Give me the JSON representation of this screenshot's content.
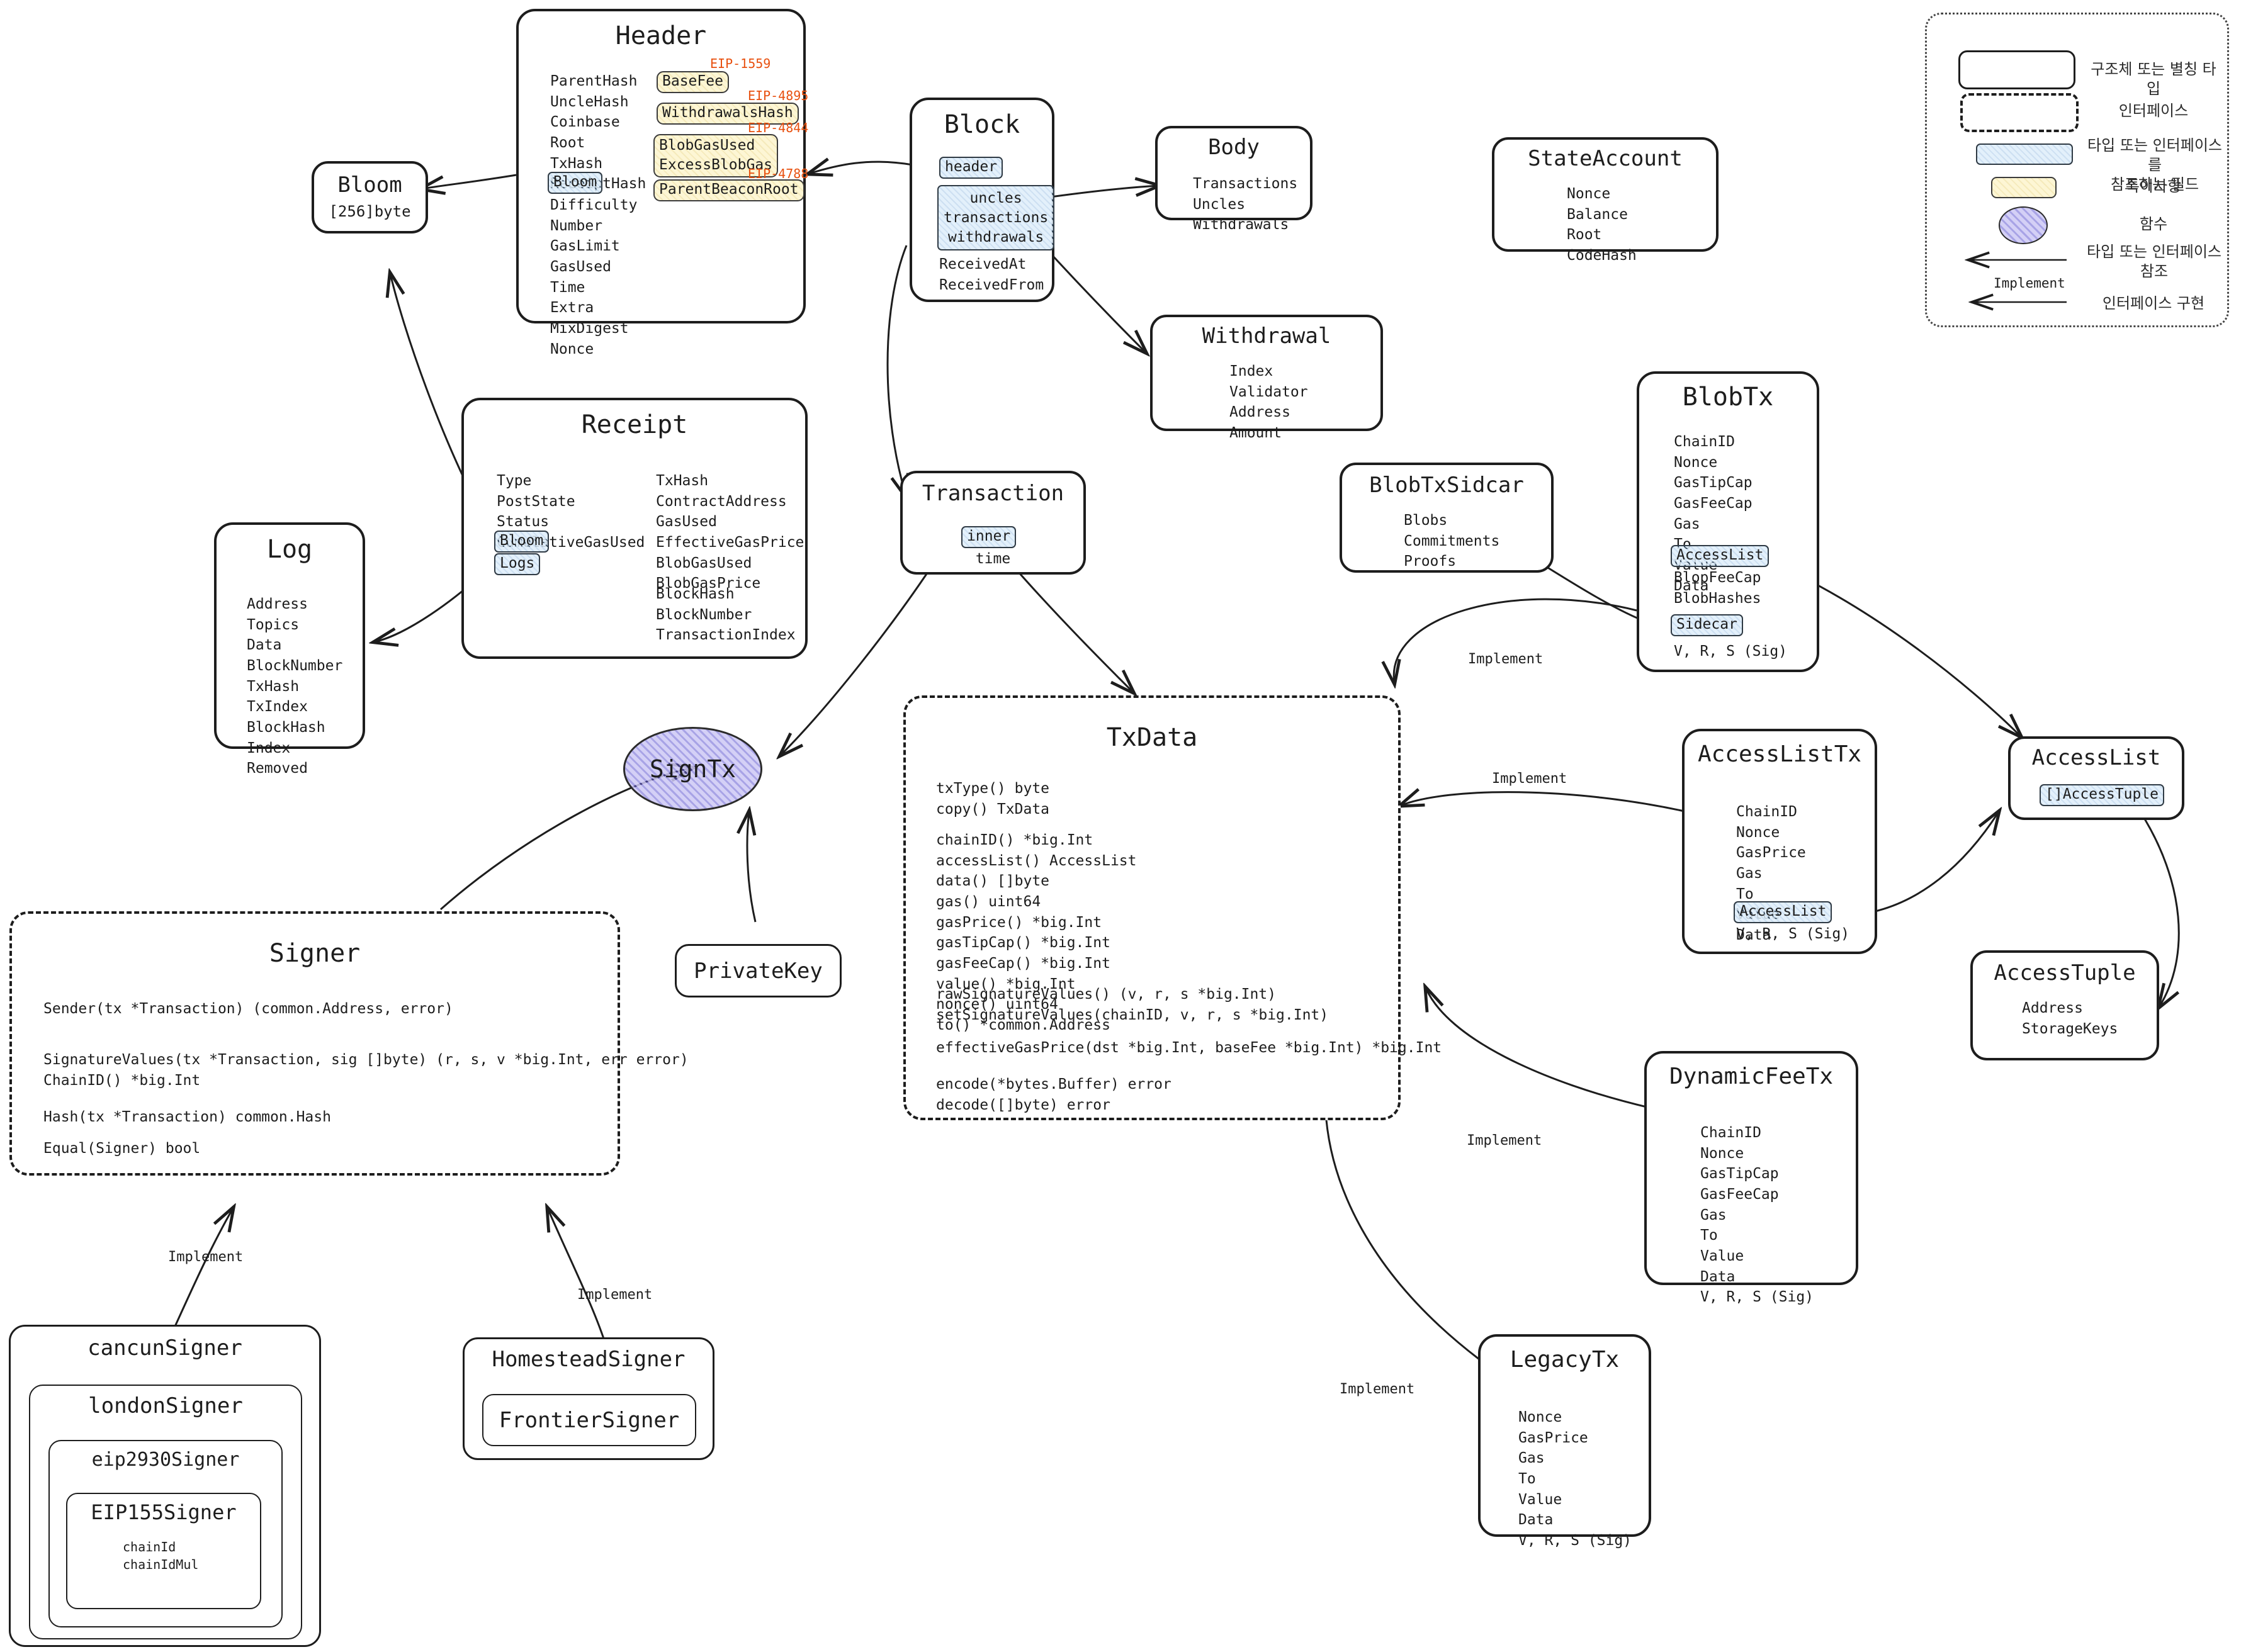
{
  "nodes": {
    "header": {
      "title": "Header",
      "fields": "ParentHash\nUncleHash\nCoinbase\nRoot\nTxHash\nReceiptHash",
      "bloom_chip": "Bloom",
      "fields2": "Difficulty\nNumber\nGasLimit\nGasUsed\nTime\nExtra\nMixDigest\nNonce",
      "eips": [
        {
          "label": "EIP-1559",
          "chip": "BaseFee"
        },
        {
          "label": "EIP-4895",
          "chip": "WithdrawalsHash"
        },
        {
          "label": "EIP-4844",
          "chip": "BlobGasUsed\nExcessBlobGas"
        },
        {
          "label": "EIP-4788",
          "chip": "ParentBeaconRoot"
        }
      ]
    },
    "bloom": {
      "title": "Bloom",
      "sub": "[256]byte"
    },
    "block": {
      "title": "Block",
      "chip_header": "header",
      "chip_body": "uncles\ntransactions\nwithdrawals",
      "fields": "ReceivedAt\nReceivedFrom"
    },
    "body": {
      "title": "Body",
      "fields": "Transactions\nUncles\nWithdrawals"
    },
    "state_account": {
      "title": "StateAccount",
      "fields": "Nonce\nBalance\nRoot\nCodeHash"
    },
    "withdrawal": {
      "title": "Withdrawal",
      "fields": "Index\nValidator\nAddress\nAmount"
    },
    "receipt": {
      "title": "Receipt",
      "col1": "Type\nPostState\nStatus\nCumulativeGasUsed",
      "chip_bloom": "Bloom",
      "chip_logs": "Logs",
      "col2": "TxHash\nContractAddress\nGasUsed\nEffectiveGasPrice\nBlobGasUsed\nBlobGasPrice",
      "col3": "BlockHash\nBlockNumber\nTransactionIndex"
    },
    "log": {
      "title": "Log",
      "fields": "Address\nTopics\nData\nBlockNumber\nTxHash\nTxIndex\nBlockHash\nIndex\nRemoved"
    },
    "transaction": {
      "title": "Transaction",
      "chip_inner": "inner",
      "sub": "time"
    },
    "sign_tx": {
      "title": "SignTx"
    },
    "private_key": {
      "title": "PrivateKey"
    },
    "txdata": {
      "title": "TxData",
      "group1": "txType() byte\ncopy() TxData",
      "group2": "chainID() *big.Int\naccessList() AccessList\ndata() []byte\ngas() uint64\ngasPrice() *big.Int\ngasTipCap() *big.Int\ngasFeeCap() *big.Int\nvalue() *big.Int\nnonce() uint64\nto() *common.Address",
      "group3": "rawSignatureValues() (v, r, s *big.Int)\nsetSignatureValues(chainID, v, r, s *big.Int)",
      "group4": "effectiveGasPrice(dst *big.Int, baseFee *big.Int) *big.Int",
      "group5": "encode(*bytes.Buffer) error\ndecode([]byte) error"
    },
    "signer": {
      "title": "Signer",
      "group1": "Sender(tx *Transaction) (common.Address, error)",
      "group2": "SignatureValues(tx *Transaction, sig []byte) (r, s, v *big.Int, err error)\nChainID() *big.Int",
      "group3": "Hash(tx *Transaction) common.Hash",
      "group4": "Equal(Signer) bool"
    },
    "cancun_signer": {
      "title": "cancunSigner"
    },
    "london_signer": {
      "title": "londonSigner"
    },
    "eip2930_signer": {
      "title": "eip2930Signer"
    },
    "eip155_signer": {
      "title": "EIP155Signer",
      "fields": "chainId\nchainIdMul"
    },
    "homestead_signer": {
      "title": "HomesteadSigner"
    },
    "frontier_signer": {
      "title": "FrontierSigner"
    },
    "blob_tx_sidecar": {
      "title": "BlobTxSidcar",
      "fields": "Blobs\nCommitments\nProofs"
    },
    "blob_tx": {
      "title": "BlobTx",
      "fields1": "ChainID\nNonce\nGasTipCap\nGasFeeCap\nGas\nTo\nValue\nData",
      "chip_accesslist": "AccessList",
      "fields2": "BlopFeeCap\nBlobHashes",
      "chip_sidecar": "Sidecar",
      "fields3": "V, R, S (Sig)"
    },
    "access_list_tx": {
      "title": "AccessListTx",
      "fields1": "ChainID\nNonce\nGasPrice\nGas\nTo\nValue\nData",
      "chip_accesslist": "AccessList",
      "fields2": "V, R, S (Sig)"
    },
    "access_list": {
      "title": "AccessList",
      "chip": "[]AccessTuple"
    },
    "access_tuple": {
      "title": "AccessTuple",
      "fields": "Address\nStorageKeys"
    },
    "dynamic_fee_tx": {
      "title": "DynamicFeeTx",
      "fields": "ChainID\nNonce\nGasTipCap\nGasFeeCap\nGas\nTo\nValue\nData\nV, R, S (Sig)"
    },
    "legacy_tx": {
      "title": "LegacyTx",
      "fields": "Nonce\nGasPrice\nGas\nTo\nValue\nData\nV, R, S (Sig)"
    }
  },
  "edge_labels": {
    "impl_blobtx": "Implement",
    "impl_accesslisttx": "Implement",
    "impl_dynamicfeetx": "Implement",
    "impl_legacytx": "Implement",
    "impl_cancun": "Implement",
    "impl_homestead": "Implement"
  },
  "legend": {
    "struct": "구조체 또는 별칭 타입",
    "interface": "인터페이스",
    "field_ref": "타입 또는 인터페이스를\n참조하는 필드",
    "note": "특이사항",
    "function": "함수",
    "type_ref": "타입 또는 인터페이스\n참조",
    "implement": "인터페이스 구현",
    "implement_arrow_label": "Implement"
  },
  "colors": {
    "eip_text": "#e8500f",
    "field_ref": "#deeefa",
    "note": "#fdf5d0",
    "function": "#cdc8f5",
    "stroke": "#1d1d1d"
  }
}
